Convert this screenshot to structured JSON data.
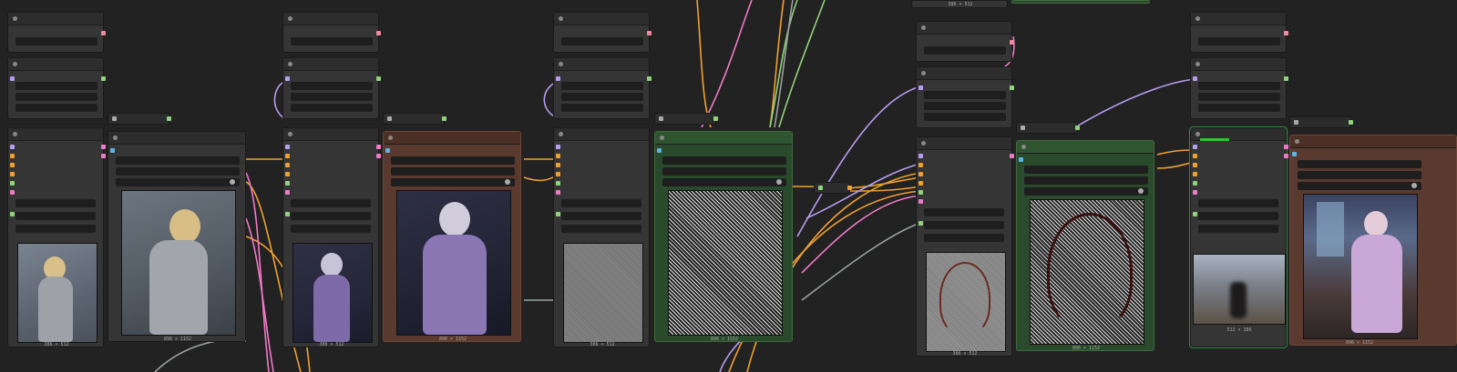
{
  "app": {
    "name": "node-graph-editor"
  },
  "colors": {
    "canvas": "#222222",
    "node_body": "#353535",
    "group_green": "#2a4a2c",
    "group_brown": "#5a3a2f",
    "wire_orange": "#f0a030",
    "wire_purple": "#b69cf0",
    "wire_pink": "#f07ac8",
    "wire_green": "#8fd47a",
    "wire_gray": "#9aa0a0"
  },
  "previews": {
    "p1": {
      "label": "386 × 512",
      "content": "blonde-woman-grey-dress-small"
    },
    "p2": {
      "label": "896 × 1152",
      "content": "blonde-woman-grey-dress-large"
    },
    "p3": {
      "label": "386 × 512",
      "content": "purple-fantasy-woman-small"
    },
    "p4": {
      "label": "896 × 1152",
      "content": "purple-fantasy-woman-large"
    },
    "p5": {
      "label": "386 × 512",
      "content": "noise-mask-small"
    },
    "p6": {
      "label": "896 × 1152",
      "content": "noise-mask-large"
    },
    "p7": {
      "label": "386 × 512",
      "content": "outline-sketch-small"
    },
    "p8": {
      "label": "896 × 1152",
      "content": "outline-sketch-large"
    },
    "p9": {
      "label": "512 × 386",
      "content": "blurred-crowd"
    },
    "p10": {
      "label": "896 × 1152",
      "content": "fantasy-woman-window"
    },
    "top": {
      "label": "386 × 512"
    }
  }
}
